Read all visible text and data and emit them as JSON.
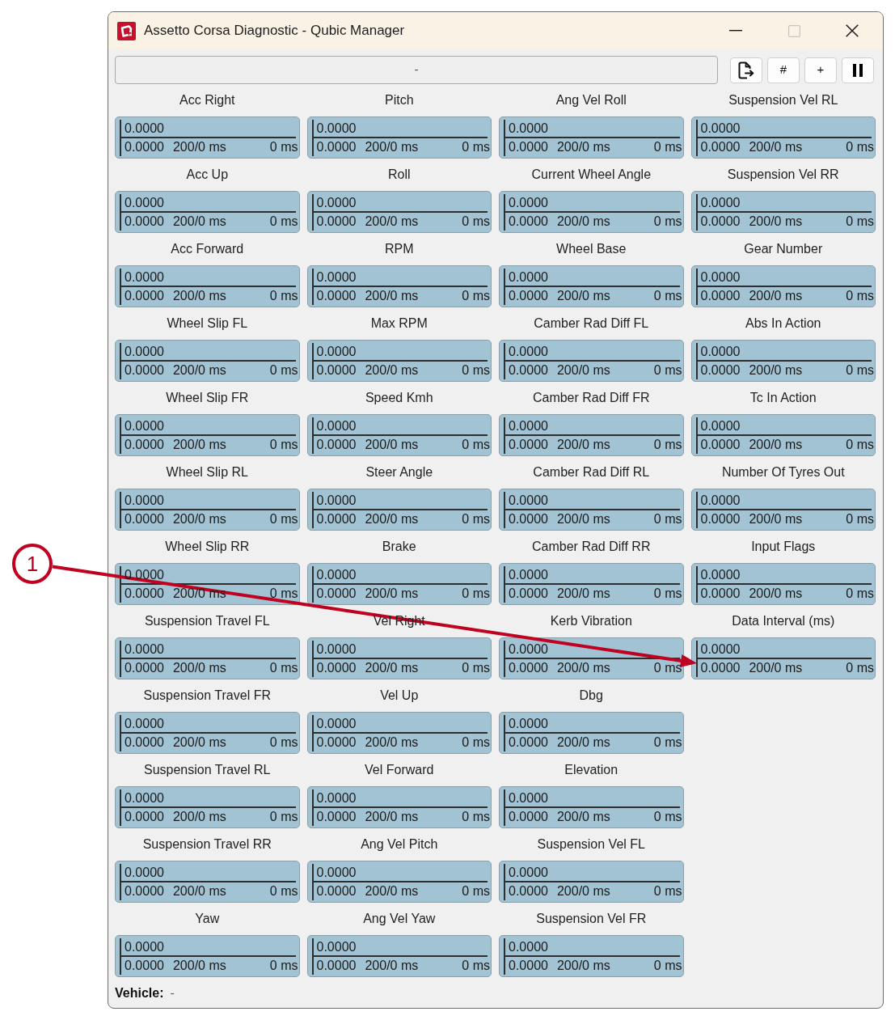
{
  "window": {
    "title": "Assetto Corsa Diagnostic - Qubic Manager",
    "controls": [
      {
        "kind": "minimize",
        "disabled": false
      },
      {
        "kind": "maximize",
        "disabled": true
      },
      {
        "kind": "close",
        "disabled": false
      }
    ]
  },
  "toolbar": {
    "status_text": "-",
    "buttons": [
      {
        "kind": "export"
      },
      {
        "kind": "text",
        "label": "#"
      },
      {
        "kind": "text",
        "label": "+"
      },
      {
        "kind": "pause"
      }
    ]
  },
  "gauge_rows": [
    [
      {
        "label": "Acc Right",
        "value": "0.0000",
        "detail_value": "0.0000",
        "detail_period": "200/0 ms",
        "detail_right": "0 ms"
      },
      {
        "label": "Pitch",
        "value": "0.0000",
        "detail_value": "0.0000",
        "detail_period": "200/0 ms",
        "detail_right": "0 ms"
      },
      {
        "label": "Ang Vel Roll",
        "value": "0.0000",
        "detail_value": "0.0000",
        "detail_period": "200/0 ms",
        "detail_right": "0 ms"
      },
      {
        "label": "Suspension Vel RL",
        "value": "0.0000",
        "detail_value": "0.0000",
        "detail_period": "200/0 ms",
        "detail_right": "0 ms"
      }
    ],
    [
      {
        "label": "Acc Up",
        "value": "0.0000",
        "detail_value": "0.0000",
        "detail_period": "200/0 ms",
        "detail_right": "0 ms"
      },
      {
        "label": "Roll",
        "value": "0.0000",
        "detail_value": "0.0000",
        "detail_period": "200/0 ms",
        "detail_right": "0 ms"
      },
      {
        "label": "Current Wheel Angle",
        "value": "0.0000",
        "detail_value": "0.0000",
        "detail_period": "200/0 ms",
        "detail_right": "0 ms"
      },
      {
        "label": "Suspension Vel RR",
        "value": "0.0000",
        "detail_value": "0.0000",
        "detail_period": "200/0 ms",
        "detail_right": "0 ms"
      }
    ],
    [
      {
        "label": "Acc Forward",
        "value": "0.0000",
        "detail_value": "0.0000",
        "detail_period": "200/0 ms",
        "detail_right": "0 ms"
      },
      {
        "label": "RPM",
        "value": "0.0000",
        "detail_value": "0.0000",
        "detail_period": "200/0 ms",
        "detail_right": "0 ms"
      },
      {
        "label": "Wheel Base",
        "value": "0.0000",
        "detail_value": "0.0000",
        "detail_period": "200/0 ms",
        "detail_right": "0 ms"
      },
      {
        "label": "Gear Number",
        "value": "0.0000",
        "detail_value": "0.0000",
        "detail_period": "200/0 ms",
        "detail_right": "0 ms"
      }
    ],
    [
      {
        "label": "Wheel Slip FL",
        "value": "0.0000",
        "detail_value": "0.0000",
        "detail_period": "200/0 ms",
        "detail_right": "0 ms"
      },
      {
        "label": "Max RPM",
        "value": "0.0000",
        "detail_value": "0.0000",
        "detail_period": "200/0 ms",
        "detail_right": "0 ms"
      },
      {
        "label": "Camber Rad Diff FL",
        "value": "0.0000",
        "detail_value": "0.0000",
        "detail_period": "200/0 ms",
        "detail_right": "0 ms"
      },
      {
        "label": "Abs In Action",
        "value": "0.0000",
        "detail_value": "0.0000",
        "detail_period": "200/0 ms",
        "detail_right": "0 ms"
      }
    ],
    [
      {
        "label": "Wheel Slip FR",
        "value": "0.0000",
        "detail_value": "0.0000",
        "detail_period": "200/0 ms",
        "detail_right": "0 ms"
      },
      {
        "label": "Speed Kmh",
        "value": "0.0000",
        "detail_value": "0.0000",
        "detail_period": "200/0 ms",
        "detail_right": "0 ms"
      },
      {
        "label": "Camber Rad Diff FR",
        "value": "0.0000",
        "detail_value": "0.0000",
        "detail_period": "200/0 ms",
        "detail_right": "0 ms"
      },
      {
        "label": "Tc In Action",
        "value": "0.0000",
        "detail_value": "0.0000",
        "detail_period": "200/0 ms",
        "detail_right": "0 ms"
      }
    ],
    [
      {
        "label": "Wheel Slip RL",
        "value": "0.0000",
        "detail_value": "0.0000",
        "detail_period": "200/0 ms",
        "detail_right": "0 ms"
      },
      {
        "label": "Steer Angle",
        "value": "0.0000",
        "detail_value": "0.0000",
        "detail_period": "200/0 ms",
        "detail_right": "0 ms"
      },
      {
        "label": "Camber Rad Diff RL",
        "value": "0.0000",
        "detail_value": "0.0000",
        "detail_period": "200/0 ms",
        "detail_right": "0 ms"
      },
      {
        "label": "Number Of Tyres Out",
        "value": "0.0000",
        "detail_value": "0.0000",
        "detail_period": "200/0 ms",
        "detail_right": "0 ms"
      }
    ],
    [
      {
        "label": "Wheel Slip RR",
        "value": "0.0000",
        "detail_value": "0.0000",
        "detail_period": "200/0 ms",
        "detail_right": "0 ms"
      },
      {
        "label": "Brake",
        "value": "0.0000",
        "detail_value": "0.0000",
        "detail_period": "200/0 ms",
        "detail_right": "0 ms"
      },
      {
        "label": "Camber Rad Diff RR",
        "value": "0.0000",
        "detail_value": "0.0000",
        "detail_period": "200/0 ms",
        "detail_right": "0 ms"
      },
      {
        "label": "Input Flags",
        "value": "0.0000",
        "detail_value": "0.0000",
        "detail_period": "200/0 ms",
        "detail_right": "0 ms"
      }
    ],
    [
      {
        "label": "Suspension Travel FL",
        "value": "0.0000",
        "detail_value": "0.0000",
        "detail_period": "200/0 ms",
        "detail_right": "0 ms"
      },
      {
        "label": "Vel Right",
        "value": "0.0000",
        "detail_value": "0.0000",
        "detail_period": "200/0 ms",
        "detail_right": "0 ms"
      },
      {
        "label": "Kerb Vibration",
        "value": "0.0000",
        "detail_value": "0.0000",
        "detail_period": "200/0 ms",
        "detail_right": "0 ms"
      },
      {
        "label": "Data Interval (ms)",
        "value": "0.0000",
        "detail_value": "0.0000",
        "detail_period": "200/0 ms",
        "detail_right": "0 ms"
      }
    ],
    [
      {
        "label": "Suspension Travel FR",
        "value": "0.0000",
        "detail_value": "0.0000",
        "detail_period": "200/0 ms",
        "detail_right": "0 ms"
      },
      {
        "label": "Vel Up",
        "value": "0.0000",
        "detail_value": "0.0000",
        "detail_period": "200/0 ms",
        "detail_right": "0 ms"
      },
      {
        "label": "Dbg",
        "value": "0.0000",
        "detail_value": "0.0000",
        "detail_period": "200/0 ms",
        "detail_right": "0 ms"
      }
    ],
    [
      {
        "label": "Suspension Travel RL",
        "value": "0.0000",
        "detail_value": "0.0000",
        "detail_period": "200/0 ms",
        "detail_right": "0 ms"
      },
      {
        "label": "Vel Forward",
        "value": "0.0000",
        "detail_value": "0.0000",
        "detail_period": "200/0 ms",
        "detail_right": "0 ms"
      },
      {
        "label": "Elevation",
        "value": "0.0000",
        "detail_value": "0.0000",
        "detail_period": "200/0 ms",
        "detail_right": "0 ms"
      }
    ],
    [
      {
        "label": "Suspension Travel RR",
        "value": "0.0000",
        "detail_value": "0.0000",
        "detail_period": "200/0 ms",
        "detail_right": "0 ms"
      },
      {
        "label": "Ang Vel Pitch",
        "value": "0.0000",
        "detail_value": "0.0000",
        "detail_period": "200/0 ms",
        "detail_right": "0 ms"
      },
      {
        "label": "Suspension Vel FL",
        "value": "0.0000",
        "detail_value": "0.0000",
        "detail_period": "200/0 ms",
        "detail_right": "0 ms"
      }
    ],
    [
      {
        "label": "Yaw",
        "value": "0.0000",
        "detail_value": "0.0000",
        "detail_period": "200/0 ms",
        "detail_right": "0 ms"
      },
      {
        "label": "Ang Vel Yaw",
        "value": "0.0000",
        "detail_value": "0.0000",
        "detail_period": "200/0 ms",
        "detail_right": "0 ms"
      },
      {
        "label": "Suspension Vel FR",
        "value": "0.0000",
        "detail_value": "0.0000",
        "detail_period": "200/0 ms",
        "detail_right": "0 ms"
      }
    ]
  ],
  "footer": {
    "label": "Vehicle:",
    "value": "-"
  },
  "annotations": [
    {
      "label": "1"
    }
  ]
}
